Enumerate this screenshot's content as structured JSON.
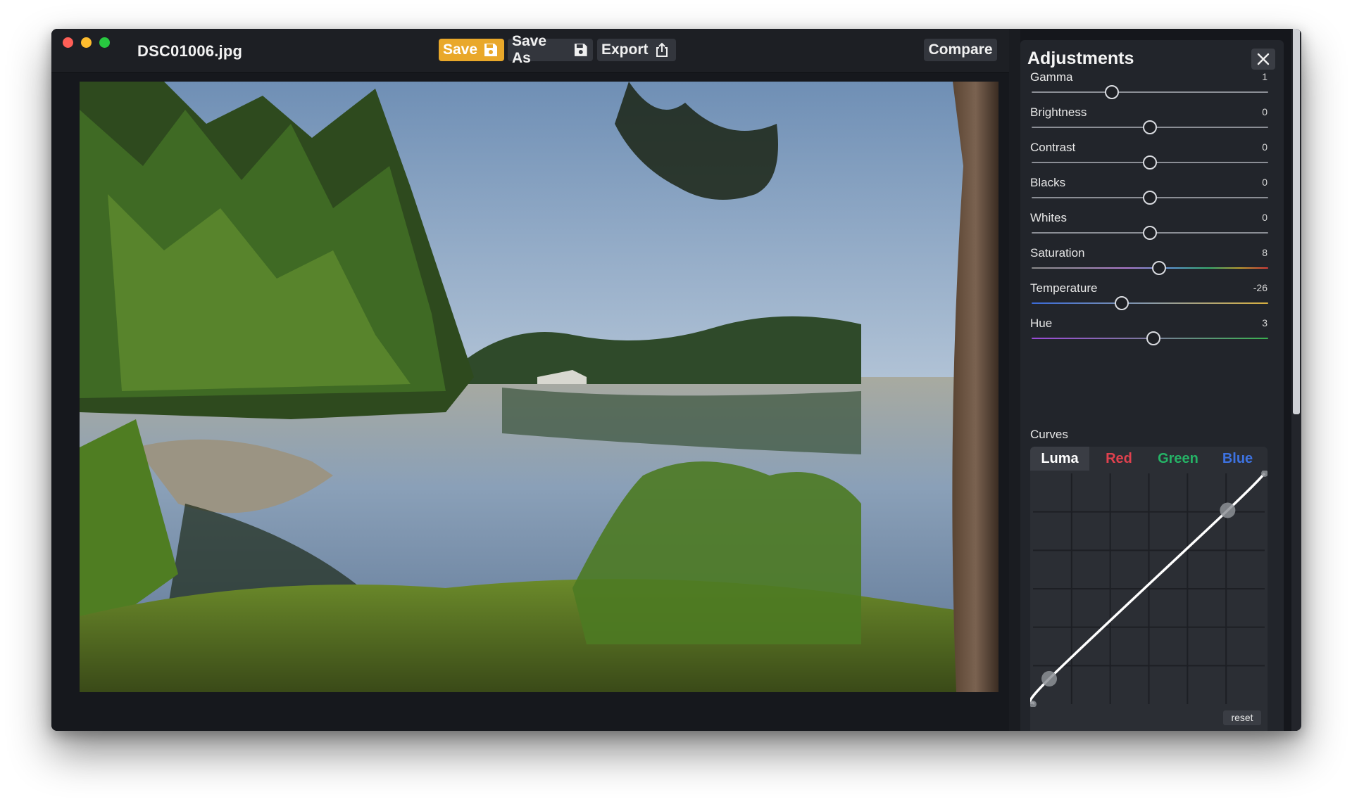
{
  "window": {
    "filename": "DSC01006.jpg",
    "traffic_lights": [
      "close",
      "minimize",
      "maximize"
    ]
  },
  "toolbar": {
    "save_label": "Save",
    "save_as_label": "Save As",
    "export_label": "Export",
    "compare_label": "Compare",
    "save_color": "#e9a82a"
  },
  "adjustments": {
    "title": "Adjustments",
    "sliders": [
      {
        "label": "Gamma",
        "value": "1",
        "level": 0.34,
        "track": "plain"
      },
      {
        "label": "Brightness",
        "value": "0",
        "level": 0.5,
        "track": "plain"
      },
      {
        "label": "Contrast",
        "value": "0",
        "level": 0.5,
        "track": "plain"
      },
      {
        "label": "Blacks",
        "value": "0",
        "level": 0.5,
        "track": "plain"
      },
      {
        "label": "Whites",
        "value": "0",
        "level": 0.5,
        "track": "plain"
      },
      {
        "label": "Saturation",
        "value": "8",
        "level": 0.54,
        "track": "saturation"
      },
      {
        "label": "Temperature",
        "value": "-26",
        "level": 0.38,
        "track": "temperature"
      },
      {
        "label": "Hue",
        "value": "3",
        "level": 0.515,
        "track": "hue"
      }
    ],
    "curves": {
      "label": "Curves",
      "tabs": [
        "Luma",
        "Red",
        "Green",
        "Blue"
      ],
      "active_tab": "Luma",
      "reset_label": "reset",
      "control_points": [
        [
          0.0,
          0.0
        ],
        [
          0.07,
          0.11
        ],
        [
          0.84,
          0.84
        ],
        [
          1.0,
          1.0
        ]
      ]
    }
  }
}
